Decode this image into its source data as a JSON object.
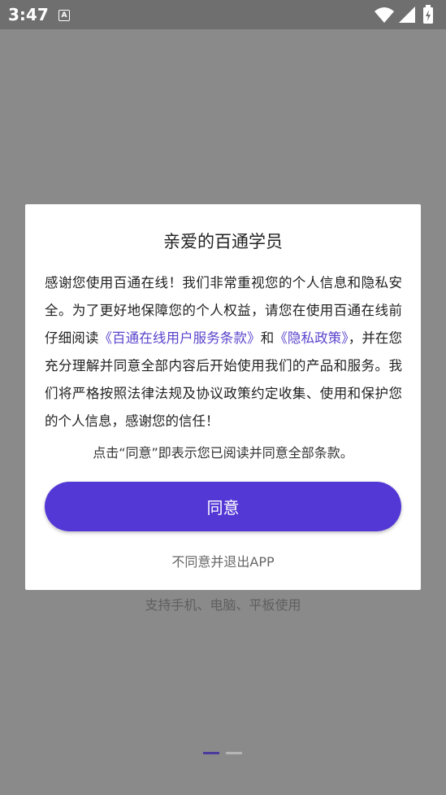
{
  "status_bar": {
    "time": "3:47",
    "notification_icon": "A",
    "icons": [
      "wifi-icon",
      "signal-icon",
      "battery-icon"
    ]
  },
  "background": {
    "caption": "支持手机、电脑、平板使用",
    "pager": {
      "pages": 2,
      "active": 0
    }
  },
  "dialog": {
    "title": "亲爱的百通学员",
    "body_part1": "感谢您使用百通在线！我们非常重视您的个人信息和隐私安全。为了更好地保障您的个人权益，请您在使用百通在线前仔细阅读",
    "link_terms": "《百通在线用户服务条款》",
    "body_and": "和",
    "link_privacy": "《隐私政策》",
    "body_part2": "，并在您充分理解并同意全部内容后开始使用我们的产品和服务。我们将严格按照法律法规及协议政策约定收集、使用和保护您的个人信息，感谢您的信任！",
    "note": "点击“同意”即表示您已阅读并同意全部条款。",
    "agree_label": "同意",
    "disagree_label": "不同意并退出APP"
  },
  "colors": {
    "accent": "#5438d6",
    "link": "#5a44cc",
    "overlay": "#8a8a8a"
  }
}
